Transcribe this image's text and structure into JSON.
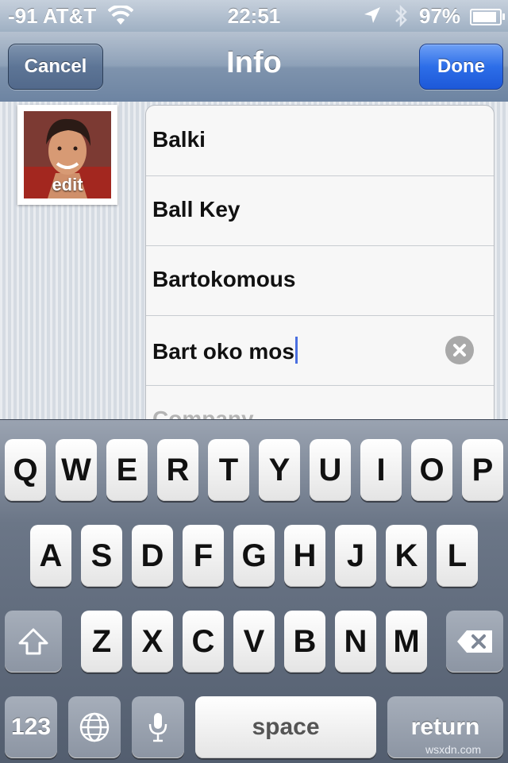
{
  "status_bar": {
    "carrier": "-91 AT&T",
    "time": "22:51",
    "battery": "97%",
    "battery_level": 0.97,
    "icons": [
      "wifi-icon",
      "location-arrow-icon",
      "bluetooth-icon",
      "battery-icon"
    ]
  },
  "nav": {
    "title": "Info",
    "cancel_label": "Cancel",
    "done_label": "Done"
  },
  "photo": {
    "edit_label": "edit"
  },
  "fields": [
    {
      "value": "Balki"
    },
    {
      "value": "Ball Key"
    },
    {
      "value": "Bartokomous"
    },
    {
      "value": "Bart oko mos"
    },
    {
      "placeholder": "Company"
    }
  ],
  "keyboard": {
    "row1": [
      "Q",
      "W",
      "E",
      "R",
      "T",
      "Y",
      "U",
      "I",
      "O",
      "P"
    ],
    "row2": [
      "A",
      "S",
      "D",
      "F",
      "G",
      "H",
      "J",
      "K",
      "L"
    ],
    "row3": [
      "Z",
      "X",
      "C",
      "V",
      "B",
      "N",
      "M"
    ],
    "numbers_label": "123",
    "space_label": "space",
    "return_label": "return"
  },
  "watermark": "wsxdn.com",
  "colors": {
    "done_button": "#2d6ee8",
    "cursor": "#4a6fe0"
  }
}
